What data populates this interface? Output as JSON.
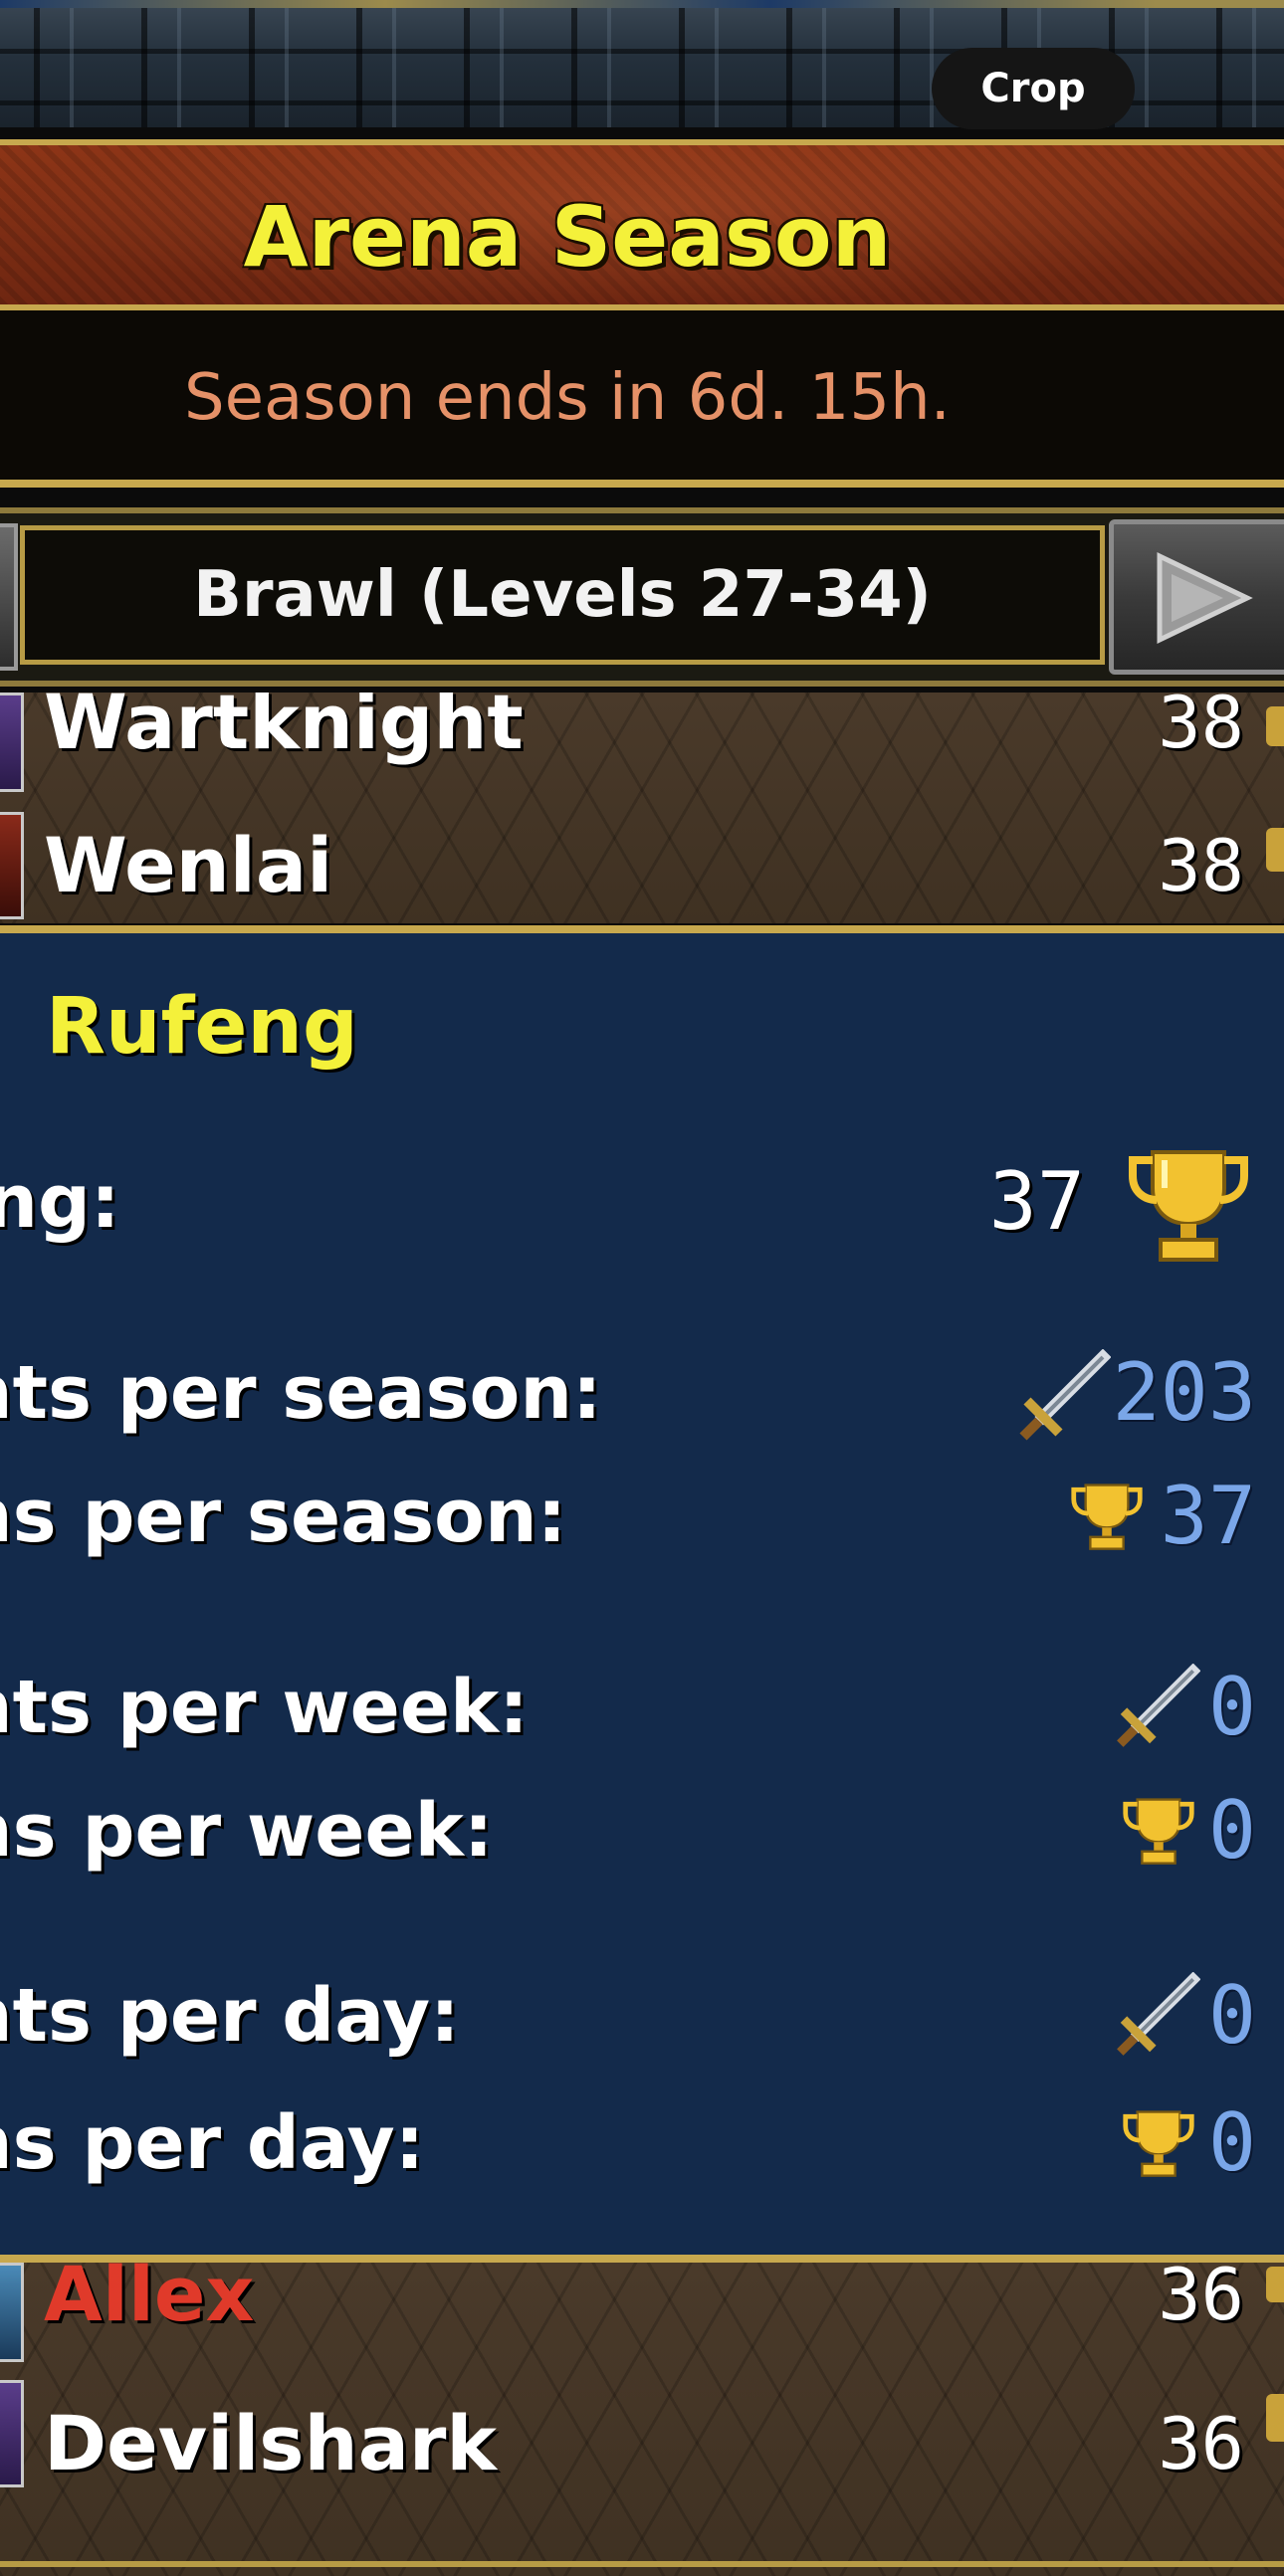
{
  "header": {
    "crop_label": "Crop",
    "title": "Arena Season",
    "season_status": "Season ends in 6d. 15h."
  },
  "bracket": {
    "label": "Brawl (Levels 27-34)"
  },
  "ranking_list_top": [
    {
      "name": "Wartknight",
      "level": "38"
    },
    {
      "name": "Wenlai",
      "level": "38"
    }
  ],
  "player_detail": {
    "name": "Rufeng",
    "stats": [
      {
        "label": "ing:",
        "value": "37",
        "icon": "trophy-icon"
      },
      {
        "label": "nts per season:",
        "value": "203",
        "icon": "sword-icon"
      },
      {
        "label": "ns per season:",
        "value": "37",
        "icon": "trophy-icon"
      },
      {
        "label": "nts per week:",
        "value": "0",
        "icon": "sword-icon"
      },
      {
        "label": "ns per week:",
        "value": "0",
        "icon": "trophy-icon"
      },
      {
        "label": "nts per day:",
        "value": "0",
        "icon": "sword-icon"
      },
      {
        "label": "ns per day:",
        "value": "0",
        "icon": "trophy-icon"
      }
    ]
  },
  "ranking_list_bottom": [
    {
      "name": "Allex",
      "level": "36",
      "name_color": "#e03a2a"
    },
    {
      "name": "Devilshark",
      "level": "36"
    }
  ],
  "colors": {
    "title_yellow": "#f4f13a",
    "season_text": "#e59168",
    "panel_blue": "#132a4b",
    "stat_blue": "#7aa6e8",
    "gold_border": "#c7a84e"
  }
}
